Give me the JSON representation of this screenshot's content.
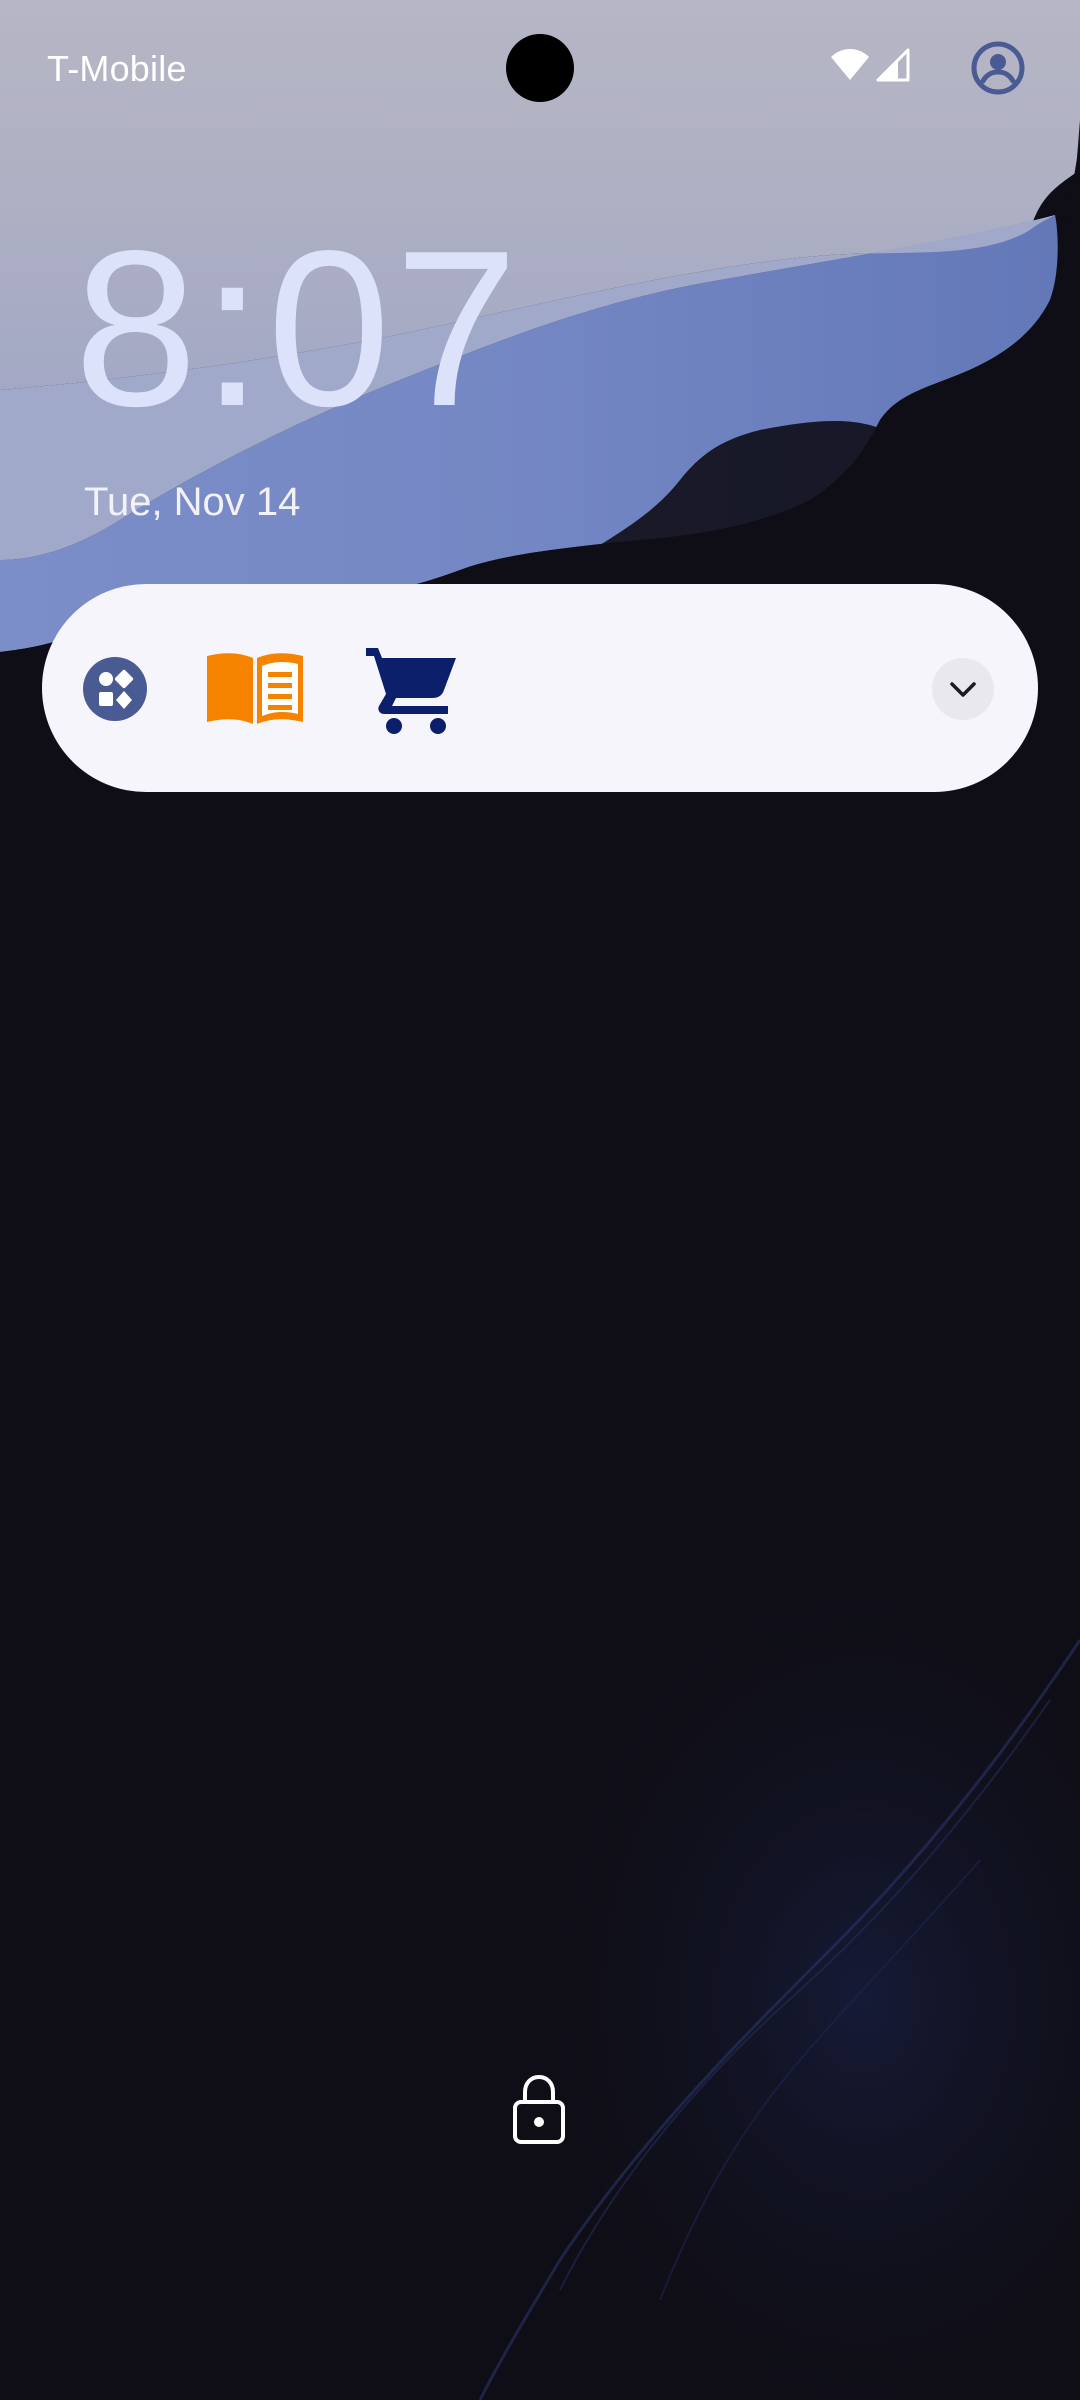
{
  "status_bar": {
    "carrier": "T-Mobile",
    "icons": [
      "wifi-icon",
      "cell-signal-icon",
      "account-icon"
    ]
  },
  "lockscreen": {
    "time": "8:07",
    "date": "Tue, Nov 14"
  },
  "shortcut_card": {
    "apps": [
      "assistant-shapes-icon",
      "book-reader-icon",
      "shopping-cart-icon"
    ],
    "expand_icon": "chevron-down-icon"
  },
  "bottom": {
    "icon": "lock-icon"
  },
  "colors": {
    "clock_text": "#dde2fb",
    "card_background": "#f6f5fb",
    "assistant_icon": "#4a5a93",
    "reader_icon": "#f58300",
    "cart_icon": "#0b1f6b",
    "wallpaper_dark": "#0f0e16",
    "wallpaper_blue": "#6f82c1"
  }
}
